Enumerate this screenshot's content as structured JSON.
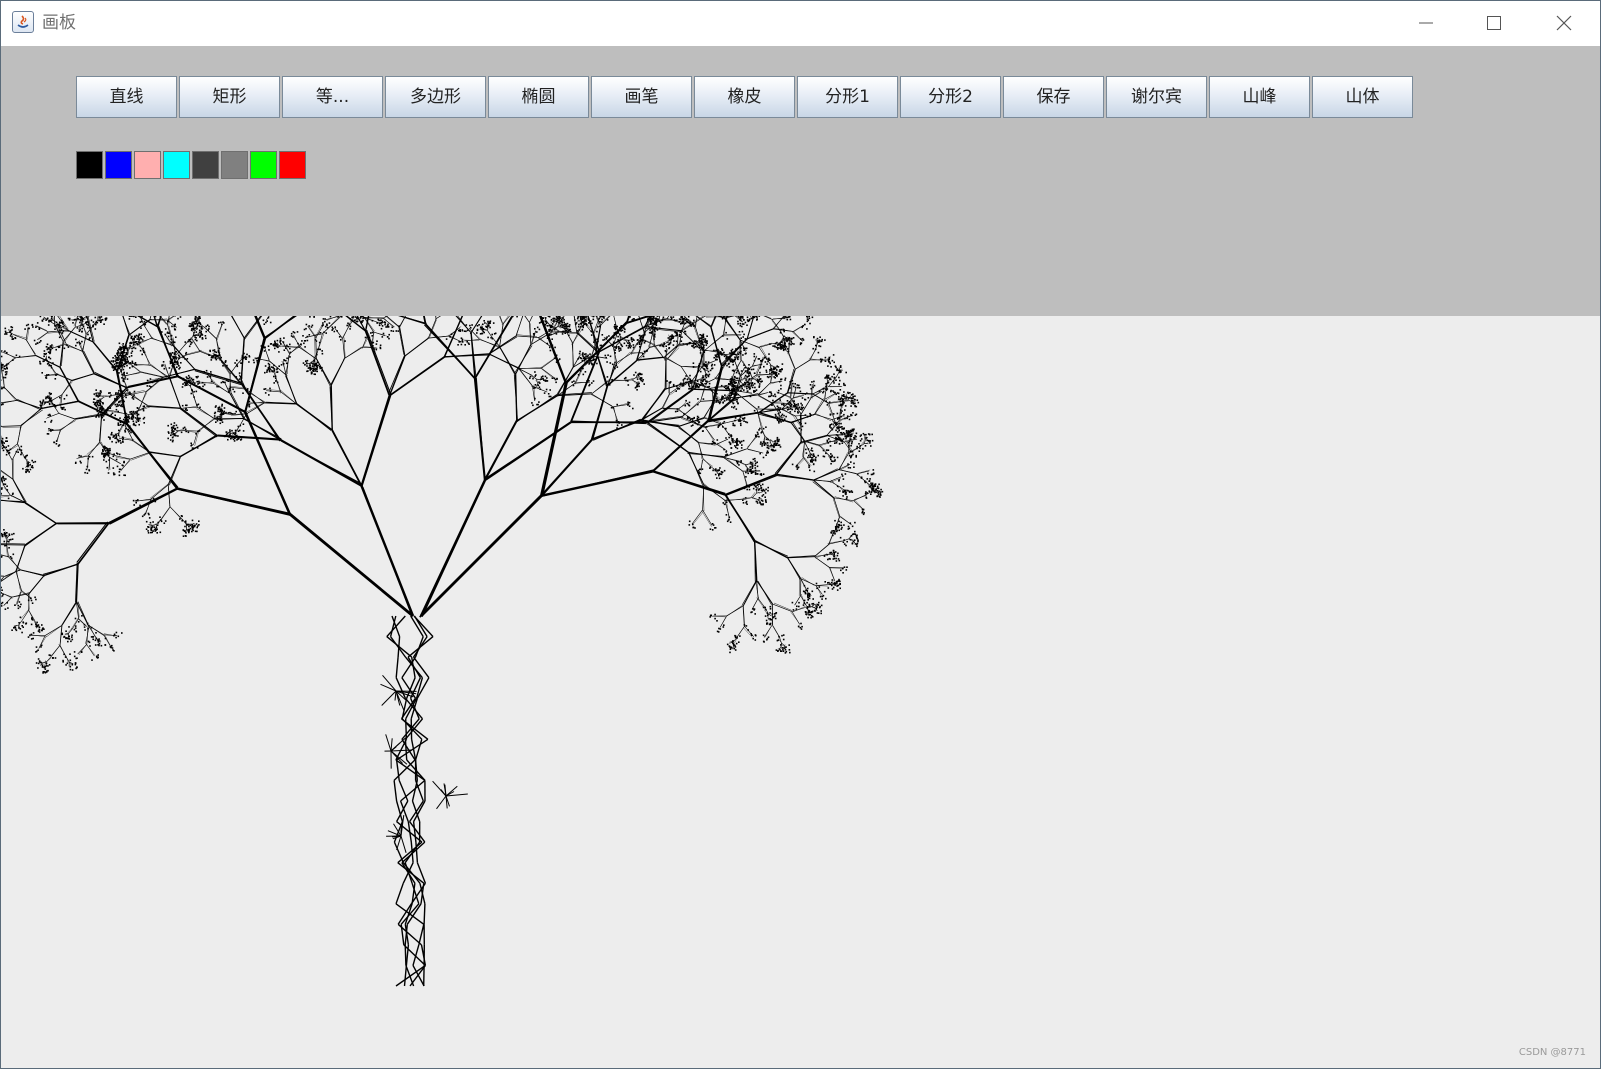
{
  "window": {
    "title": "画板",
    "controls": {
      "minimize": "minimize-icon",
      "maximize": "maximize-icon",
      "close": "close-icon"
    }
  },
  "toolbar": {
    "buttons": [
      "直线",
      "矩形",
      "等...",
      "多边形",
      "椭圆",
      "画笔",
      "橡皮",
      "分形1",
      "分形2",
      "保存",
      "谢尔宾",
      "山峰",
      "山体"
    ]
  },
  "palette": {
    "colors": [
      "#000000",
      "#0000ff",
      "#ffafaf",
      "#00ffff",
      "#404040",
      "#808080",
      "#00ff00",
      "#ff0000"
    ]
  },
  "canvas": {
    "drawing": "fractal-tree",
    "stroke_color": "#000000"
  },
  "watermark": "CSDN @8771"
}
